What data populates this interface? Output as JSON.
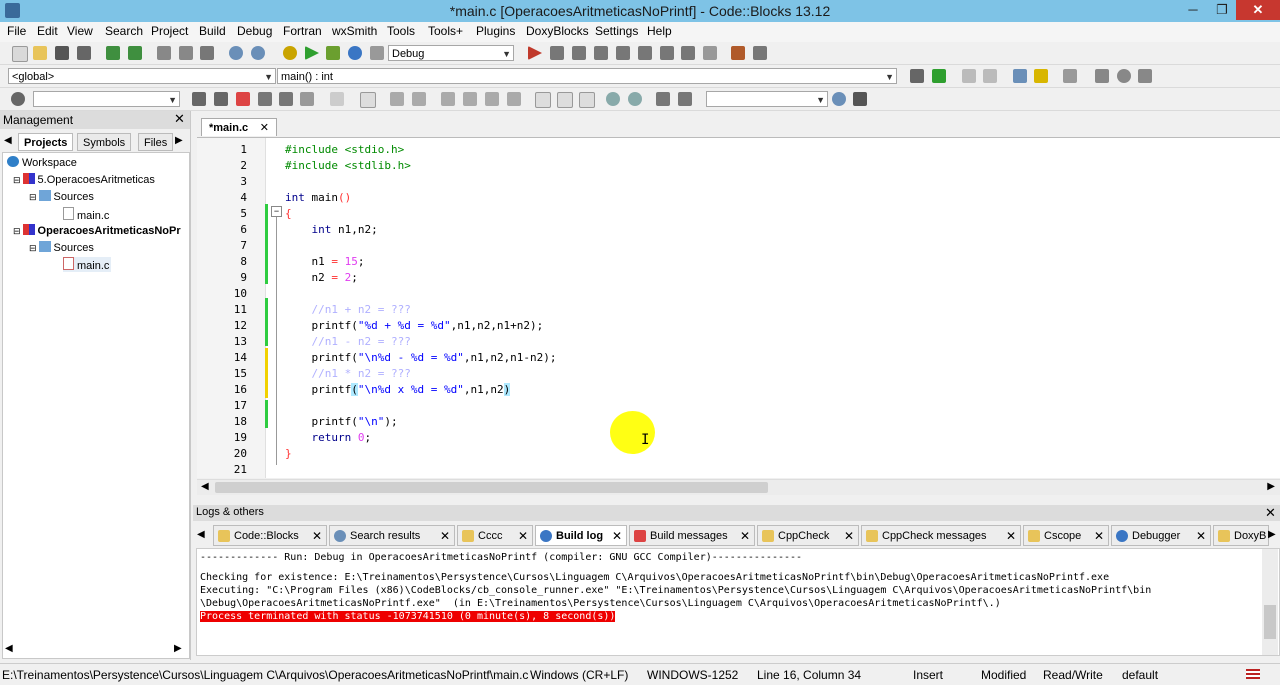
{
  "window": {
    "title": "*main.c [OperacoesAritmeticasNoPrintf] - Code::Blocks 13.12"
  },
  "menu": [
    "File",
    "Edit",
    "View",
    "Search",
    "Project",
    "Build",
    "Debug",
    "Fortran",
    "wxSmith",
    "Tools",
    "Tools+",
    "Plugins",
    "DoxyBlocks",
    "Settings",
    "Help"
  ],
  "toolbar": {
    "build_target": "Debug",
    "scope": "<global>",
    "function": "main() : int",
    "search_value": "",
    "find_value": ""
  },
  "management": {
    "title": "Management",
    "tabs": [
      "Projects",
      "Symbols",
      "Files"
    ],
    "tree": {
      "workspace": "Workspace",
      "projects": [
        {
          "name": "5.OperacoesAritmeticas",
          "folder": "Sources",
          "file": "main.c"
        },
        {
          "name": "OperacoesAritmeticasNoPr",
          "folder": "Sources",
          "file": "main.c"
        }
      ]
    }
  },
  "editor": {
    "tab": "*main.c",
    "lines": [
      "1",
      "2",
      "3",
      "4",
      "5",
      "6",
      "7",
      "8",
      "9",
      "10",
      "11",
      "12",
      "13",
      "14",
      "15",
      "16",
      "17",
      "18",
      "19",
      "20",
      "21"
    ]
  },
  "logs": {
    "title": "Logs & others",
    "tabs": [
      "Code::Blocks",
      "Search results",
      "Cccc",
      "Build log",
      "Build messages",
      "CppCheck",
      "CppCheck messages",
      "Cscope",
      "Debugger",
      "DoxyB"
    ],
    "lines": [
      "------------- Run: Debug in OperacoesAritmeticasNoPrintf (compiler: GNU GCC Compiler)---------------",
      "Checking for existence: E:\\Treinamentos\\Persystence\\Cursos\\Linguagem C\\Arquivos\\OperacoesAritmeticasNoPrintf\\bin\\Debug\\OperacoesAritmeticasNoPrintf.exe",
      "Executing: \"C:\\Program Files (x86)\\CodeBlocks/cb_console_runner.exe\" \"E:\\Treinamentos\\Persystence\\Cursos\\Linguagem C\\Arquivos\\OperacoesAritmeticasNoPrintf\\bin",
      "\\Debug\\OperacoesAritmeticasNoPrintf.exe\"  (in E:\\Treinamentos\\Persystence\\Cursos\\Linguagem C\\Arquivos\\OperacoesAritmeticasNoPrintf\\.)",
      "Process terminated with status -1073741510 (0 minute(s), 8 second(s))"
    ]
  },
  "status": {
    "path": "E:\\Treinamentos\\Persystence\\Cursos\\Linguagem C\\Arquivos\\OperacoesAritmeticasNoPrintf\\main.c",
    "eol": "Windows (CR+LF)",
    "encoding": "WINDOWS-1252",
    "position": "Line 16, Column 34",
    "mode": "Insert",
    "modified": "Modified",
    "access": "Read/Write",
    "profile": "default"
  }
}
